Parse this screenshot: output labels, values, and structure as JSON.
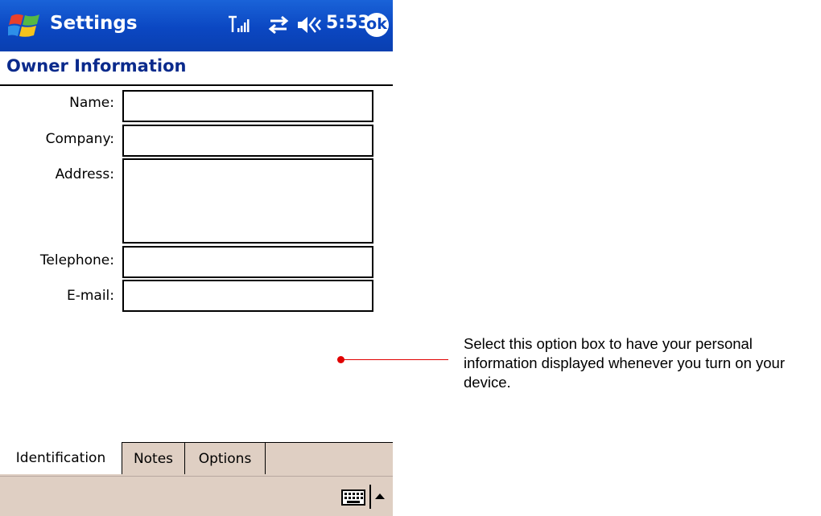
{
  "titlebar": {
    "start_icon": "windows-flag-icon",
    "title": "Settings",
    "status_icons": [
      "signal-strength-icon",
      "sync-arrows-icon",
      "volume-icon"
    ],
    "time": "5:53",
    "ok_label": "ok",
    "color": "#0b47c2"
  },
  "page": {
    "title": "Owner Information",
    "title_color": "#0a2a8c"
  },
  "form": {
    "name": {
      "label": "Name:",
      "value": ""
    },
    "company": {
      "label": "Company:",
      "value": ""
    },
    "address": {
      "label": "Address:",
      "value": ""
    },
    "telephone": {
      "label": "Telephone:",
      "value": ""
    },
    "email": {
      "label": "E-mail:",
      "value": ""
    }
  },
  "tabs": {
    "identification": "Identification",
    "notes": "Notes",
    "options": "Options",
    "active": "Identification"
  },
  "commandbar": {
    "icons": [
      "keyboard-icon",
      "up-arrow-icon"
    ],
    "color": "#dfcfc3"
  },
  "annotation": {
    "text": "Select this option box to have your personal information displayed whenever you turn on your device.",
    "color": "#e00000"
  }
}
